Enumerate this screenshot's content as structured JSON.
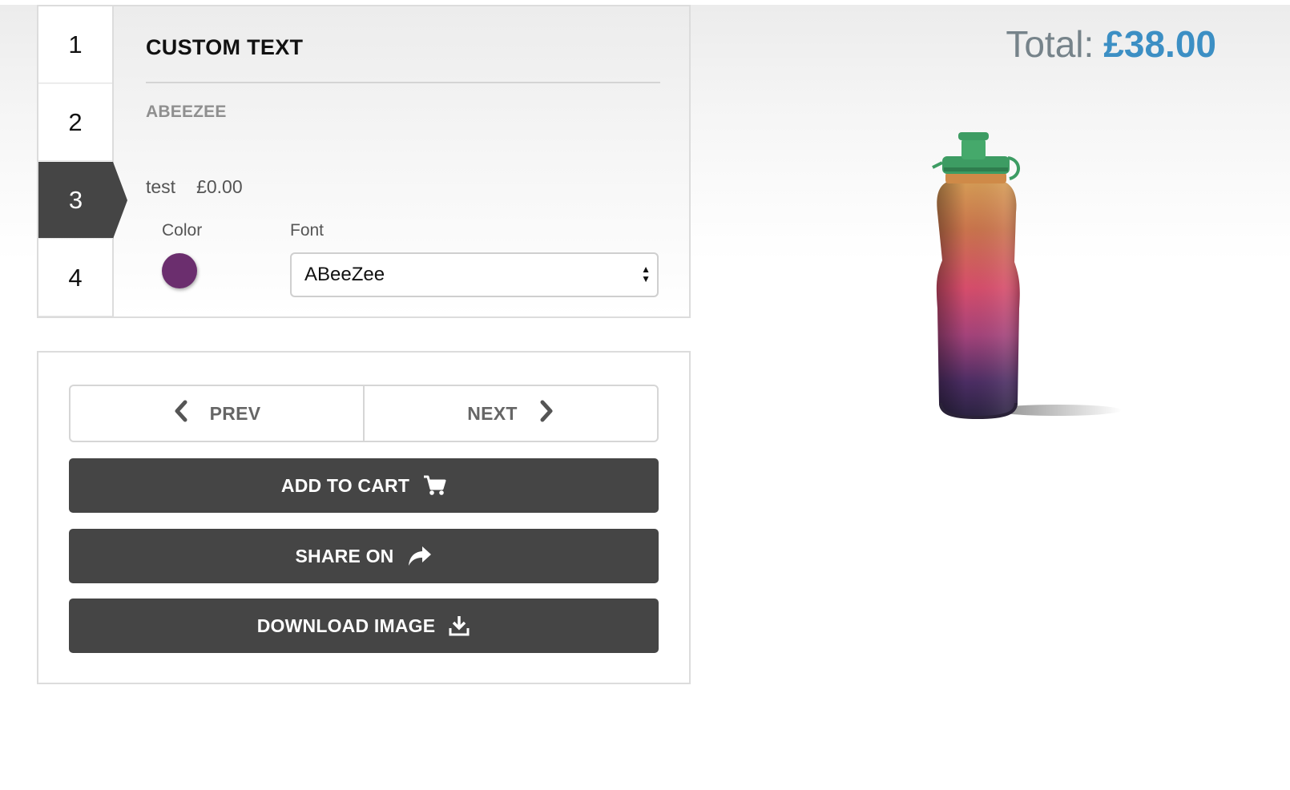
{
  "steps": [
    "1",
    "2",
    "3",
    "4"
  ],
  "active_step": "3",
  "panel": {
    "title": "CUSTOM TEXT",
    "font_heading": "ABEEZEE",
    "item_name": "test",
    "item_price": "£0.00",
    "color_label": "Color",
    "font_label": "Font",
    "selected_color": "#6b2e6e",
    "font_value": "ABeeZee"
  },
  "actions": {
    "prev_label": "PREV",
    "next_label": "NEXT",
    "add_to_cart_label": "ADD TO CART",
    "share_label": "SHARE ON",
    "download_label": "DOWNLOAD IMAGE"
  },
  "total": {
    "label": "Total:",
    "amount": "£38.00"
  },
  "product": {
    "icon": "water-bottle-image",
    "cap_color": "#3d9c63"
  },
  "colors": {
    "dark_button": "#454545",
    "accent_price": "#3c8fc4"
  }
}
